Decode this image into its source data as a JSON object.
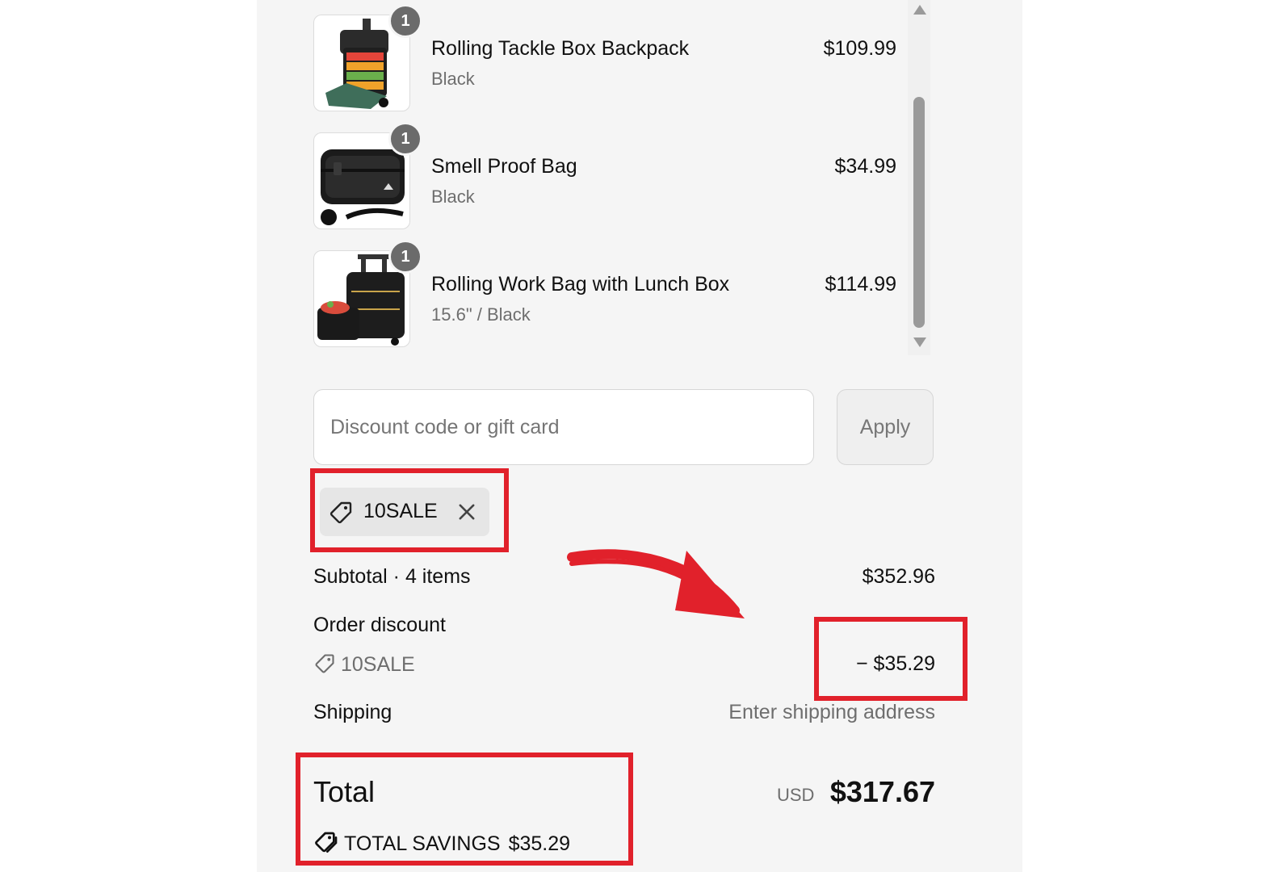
{
  "items": [
    {
      "name": "Rolling Tackle Box Backpack",
      "variant": "Black",
      "price": "$109.99",
      "qty": "1"
    },
    {
      "name": "Smell Proof Bag",
      "variant": "Black",
      "price": "$34.99",
      "qty": "1"
    },
    {
      "name": "Rolling Work Bag with Lunch Box",
      "variant": "15.6\" / Black",
      "price": "$114.99",
      "qty": "1"
    }
  ],
  "discount": {
    "placeholder": "Discount code or gift card",
    "apply_label": "Apply",
    "applied_code": "10SALE"
  },
  "summary": {
    "subtotal_label": "Subtotal · 4 items",
    "subtotal_value": "$352.96",
    "order_discount_label": "Order discount",
    "order_discount_code": "10SALE",
    "order_discount_value": "− $35.29",
    "shipping_label": "Shipping",
    "shipping_value": "Enter shipping address",
    "total_label": "Total",
    "currency": "USD",
    "total_value": "$317.67",
    "savings_label": "TOTAL SAVINGS",
    "savings_value": "$35.29"
  },
  "colors": {
    "annotation": "#e1212b",
    "qty_badge": "#6b6b6b",
    "panel_bg": "#f5f5f5"
  }
}
